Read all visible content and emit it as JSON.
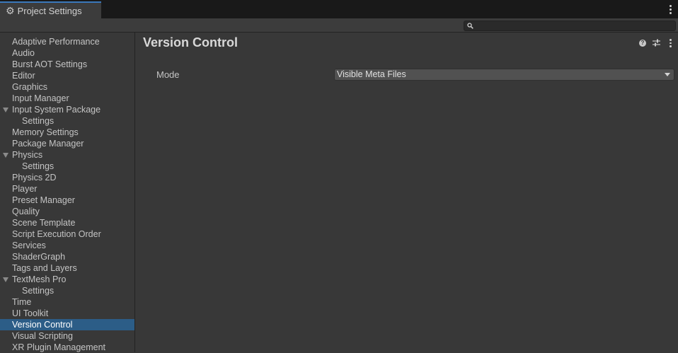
{
  "window": {
    "tab_title": "Project Settings",
    "tab_icon": "gear-icon",
    "accent_color": "#3a79bb"
  },
  "search": {
    "value": "",
    "icon": "search-icon"
  },
  "sidebar": {
    "selected_color": "#2c5d87",
    "items": [
      {
        "label": "Adaptive Performance",
        "level": 0,
        "expanded": null,
        "selected": false
      },
      {
        "label": "Audio",
        "level": 0,
        "expanded": null,
        "selected": false
      },
      {
        "label": "Burst AOT Settings",
        "level": 0,
        "expanded": null,
        "selected": false
      },
      {
        "label": "Editor",
        "level": 0,
        "expanded": null,
        "selected": false
      },
      {
        "label": "Graphics",
        "level": 0,
        "expanded": null,
        "selected": false
      },
      {
        "label": "Input Manager",
        "level": 0,
        "expanded": null,
        "selected": false
      },
      {
        "label": "Input System Package",
        "level": 0,
        "expanded": true,
        "selected": false
      },
      {
        "label": "Settings",
        "level": 1,
        "expanded": null,
        "selected": false
      },
      {
        "label": "Memory Settings",
        "level": 0,
        "expanded": null,
        "selected": false
      },
      {
        "label": "Package Manager",
        "level": 0,
        "expanded": null,
        "selected": false
      },
      {
        "label": "Physics",
        "level": 0,
        "expanded": true,
        "selected": false
      },
      {
        "label": "Settings",
        "level": 1,
        "expanded": null,
        "selected": false
      },
      {
        "label": "Physics 2D",
        "level": 0,
        "expanded": null,
        "selected": false
      },
      {
        "label": "Player",
        "level": 0,
        "expanded": null,
        "selected": false
      },
      {
        "label": "Preset Manager",
        "level": 0,
        "expanded": null,
        "selected": false
      },
      {
        "label": "Quality",
        "level": 0,
        "expanded": null,
        "selected": false
      },
      {
        "label": "Scene Template",
        "level": 0,
        "expanded": null,
        "selected": false
      },
      {
        "label": "Script Execution Order",
        "level": 0,
        "expanded": null,
        "selected": false
      },
      {
        "label": "Services",
        "level": 0,
        "expanded": null,
        "selected": false
      },
      {
        "label": "ShaderGraph",
        "level": 0,
        "expanded": null,
        "selected": false
      },
      {
        "label": "Tags and Layers",
        "level": 0,
        "expanded": null,
        "selected": false
      },
      {
        "label": "TextMesh Pro",
        "level": 0,
        "expanded": true,
        "selected": false
      },
      {
        "label": "Settings",
        "level": 1,
        "expanded": null,
        "selected": false
      },
      {
        "label": "Time",
        "level": 0,
        "expanded": null,
        "selected": false
      },
      {
        "label": "UI Toolkit",
        "level": 0,
        "expanded": null,
        "selected": false
      },
      {
        "label": "Version Control",
        "level": 0,
        "expanded": null,
        "selected": true
      },
      {
        "label": "Visual Scripting",
        "level": 0,
        "expanded": null,
        "selected": false
      },
      {
        "label": "XR Plugin Management",
        "level": 0,
        "expanded": null,
        "selected": false
      }
    ]
  },
  "content": {
    "title": "Version Control",
    "header_icons": [
      "help-icon",
      "preset-icon",
      "kebab-menu-icon"
    ],
    "fields": {
      "mode_label": "Mode",
      "mode_value": "Visible Meta Files"
    }
  }
}
